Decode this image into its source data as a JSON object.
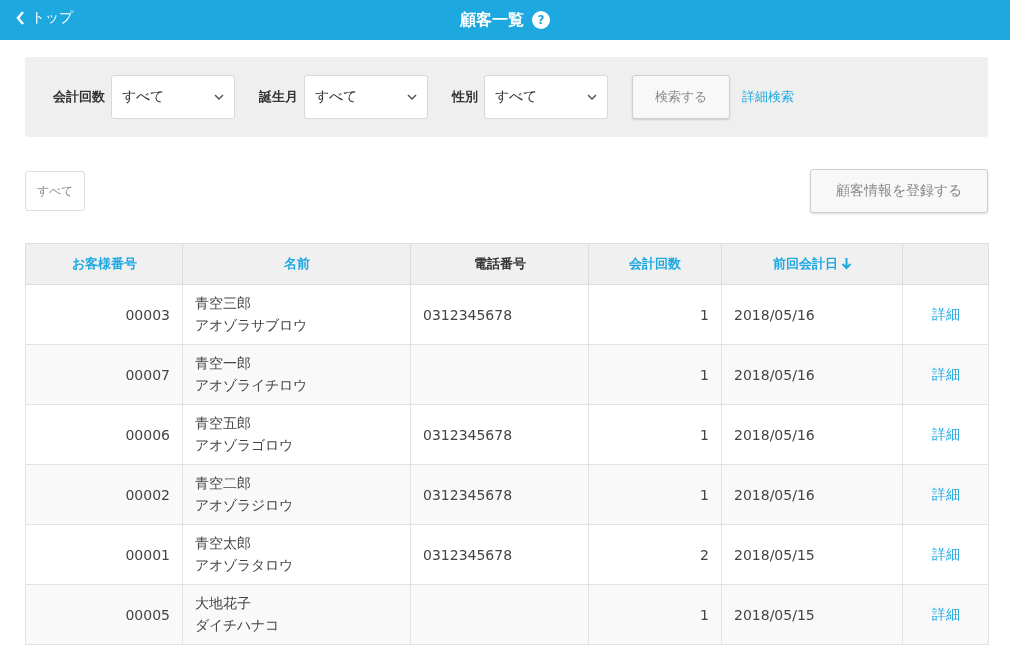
{
  "header": {
    "back": "トップ",
    "title": "顧客一覧",
    "help": "?"
  },
  "filters": [
    {
      "label": "会計回数",
      "value": "すべて"
    },
    {
      "label": "誕生月",
      "value": "すべて"
    },
    {
      "label": "性別",
      "value": "すべて"
    }
  ],
  "search_button": "検索する",
  "advanced_search": "詳細検索",
  "filter_chip": "すべて",
  "register_button": "顧客情報を登録する",
  "table": {
    "columns": [
      {
        "label": "お客様番号",
        "sortable": true,
        "sorted_descending": false
      },
      {
        "label": "名前",
        "sortable": true,
        "sorted_descending": false
      },
      {
        "label": "電話番号",
        "sortable": false,
        "sorted_descending": false
      },
      {
        "label": "会計回数",
        "sortable": true,
        "sorted_descending": false
      },
      {
        "label": "前回会計日",
        "sortable": true,
        "sorted_descending": true
      }
    ],
    "rows": [
      {
        "number": "00003",
        "name": "青空三郎",
        "kana": "アオゾラサブロウ",
        "phone": "0312345678",
        "visits": "1",
        "last_visit": "2018/05/16",
        "detail": "詳細"
      },
      {
        "number": "00007",
        "name": "青空一郎",
        "kana": "アオゾライチロウ",
        "phone": "",
        "visits": "1",
        "last_visit": "2018/05/16",
        "detail": "詳細"
      },
      {
        "number": "00006",
        "name": "青空五郎",
        "kana": "アオゾラゴロウ",
        "phone": "0312345678",
        "visits": "1",
        "last_visit": "2018/05/16",
        "detail": "詳細"
      },
      {
        "number": "00002",
        "name": "青空二郎",
        "kana": "アオゾラジロウ",
        "phone": "0312345678",
        "visits": "1",
        "last_visit": "2018/05/16",
        "detail": "詳細"
      },
      {
        "number": "00001",
        "name": "青空太郎",
        "kana": "アオゾラタロウ",
        "phone": "0312345678",
        "visits": "2",
        "last_visit": "2018/05/15",
        "detail": "詳細"
      },
      {
        "number": "00005",
        "name": "大地花子",
        "kana": "ダイチハナコ",
        "phone": "",
        "visits": "1",
        "last_visit": "2018/05/15",
        "detail": "詳細"
      }
    ]
  }
}
